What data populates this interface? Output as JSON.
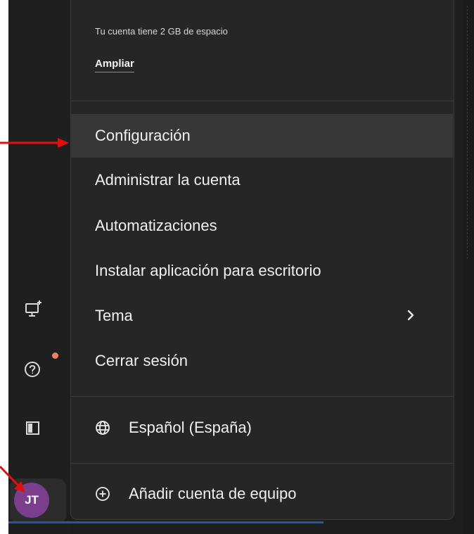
{
  "menu": {
    "storage_text": "Tu cuenta tiene 2 GB de espacio",
    "expand_link": "Ampliar",
    "items": [
      {
        "label": "Configuración"
      },
      {
        "label": "Administrar la cuenta"
      },
      {
        "label": "Automatizaciones"
      },
      {
        "label": "Instalar aplicación para escritorio"
      },
      {
        "label": "Tema"
      },
      {
        "label": "Cerrar sesión"
      }
    ],
    "language": "Español (España)",
    "add_team_account": "Añadir cuenta de equipo"
  },
  "sidebar": {
    "avatar_initials": "JT",
    "icons": [
      "desktop-add-icon",
      "help-icon",
      "panel-toggle-icon"
    ]
  },
  "colors": {
    "menu_bg": "#262626",
    "hover_bg": "#373737",
    "avatar_bg": "#7a3e8c",
    "notification_dot": "#f08060",
    "annotation_arrow": "#e01010"
  }
}
